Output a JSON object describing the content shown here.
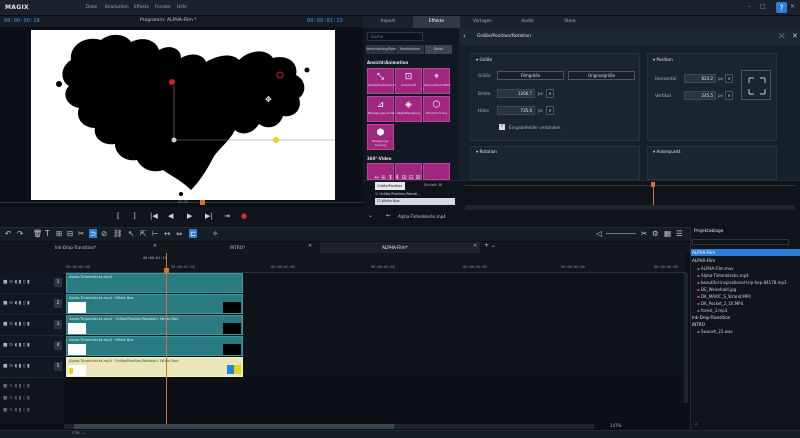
{
  "app": {
    "logo": "MAGIX"
  },
  "menu": [
    "Datei",
    "Bearbeiten",
    "Effekte",
    "Fenster",
    "Hilfe"
  ],
  "window_controls": [
    "–",
    "□",
    "✕"
  ],
  "preview": {
    "timecode_left": "00:00:00:28",
    "title": "Programm: ALPHA-Film *",
    "timecode_right": "00:00:01:23",
    "marker_label": "01:23",
    "controls": [
      "[",
      "]",
      "|◀",
      "◀",
      "▶",
      "▶|",
      "⇥",
      "●"
    ]
  },
  "right_tabs": [
    {
      "label": "Import",
      "active": false
    },
    {
      "label": "Effekte",
      "active": true
    },
    {
      "label": "Vorlagen",
      "active": false
    },
    {
      "label": "Audio",
      "active": false
    },
    {
      "label": "Store",
      "active": false
    }
  ],
  "effects": {
    "search_placeholder": "Suche",
    "subtabs": [
      "Verschiebung/Rotation",
      "Kombination",
      "Detail"
    ],
    "section_animation": "Ansicht/Animation",
    "section_360": "360°-Video",
    "tiles": [
      {
        "label": "Größe/Position/Rotation",
        "icon": "⤡"
      },
      {
        "label": "Ausschnitt",
        "icon": "⊡"
      },
      {
        "label": "Kamera/Zoomfahrt",
        "icon": "⌖"
      },
      {
        "label": "Bewegungsunschärfe",
        "icon": "⊿"
      },
      {
        "label": "Objektbewegung",
        "icon": "◈"
      },
      {
        "label": "3D-Verformung",
        "icon": "⬡"
      },
      {
        "label": "Bewegungs-tracking",
        "icon": "⬢"
      }
    ]
  },
  "properties": {
    "title": "Größe/Position/Rotation",
    "size_group": "Größe",
    "position_group": "Position",
    "rotation_group": "Rotation",
    "anchor_group": "Ankerpunkt",
    "size_label": "Größe",
    "filmsize_button": "Filmgröße",
    "originalsize_button": "Originalgröße",
    "width_label": "Breite",
    "width_value": "1206.7",
    "height_label": "Höhe",
    "height_value": "735.0",
    "unit": "px",
    "link_label": "Eingabefelder verbinden",
    "horizontal_label": "Horizontal",
    "horizontal_value": "623.2",
    "vertical_label": "Vertikal",
    "vertical_value": "245.5"
  },
  "mini_timeline": {
    "tab1": "Größe/Position",
    "tab2": "Einheit: Bl",
    "row1": "Größe/Position/Rotati...",
    "row2": "White Box",
    "clip_name": "Alpha-Tintenklecks.mp4"
  },
  "project_tabs": [
    {
      "label": "Ink-Drop-Transition*",
      "active": false
    },
    {
      "label": "INTRO*",
      "active": false
    },
    {
      "label": "ALPHA-Film*",
      "active": true
    }
  ],
  "ruler": {
    "top": "00:00:01:11",
    "ticks": [
      "00:00:00:00",
      "00:00:01:00",
      "00:00:02:00",
      "00:00:03:00",
      "00:00:04:00",
      "00:00:05:00",
      "00:00:06:00"
    ]
  },
  "tracks": [
    {
      "no": "1",
      "clip": "Alpha-Tintenklecks.mp4"
    },
    {
      "no": "2",
      "clip": "Alpha-Tintenklecks.mp4 · White Box"
    },
    {
      "no": "3",
      "clip": "Alpha-Tintenklecks.mp4 · Größe/Position/Rotation: White Box"
    },
    {
      "no": "4",
      "clip": "Alpha-Tintenklecks.mp4 · White Box"
    },
    {
      "no": "5",
      "clip": "Alpha-Tintenklecks.mp4 · Größe/Position/Rotation: White Box"
    }
  ],
  "tray": {
    "title": "Projektablage",
    "items": [
      {
        "type": "folder",
        "label": "ALPHA-Film"
      },
      {
        "type": "file",
        "label": "ALPHA-Film.mxv"
      },
      {
        "type": "file",
        "label": "Alpha-Tintenklecks.mp4"
      },
      {
        "type": "file",
        "label": "beautiful-inspirational-trip-hop-84178.mp3"
      },
      {
        "type": "file",
        "label": "DE_Weisshold.jpg"
      },
      {
        "type": "file",
        "label": "DK_MAVIC_S_Strand.MP4"
      },
      {
        "type": "file",
        "label": "DK_Pocket_2_16.MP4"
      },
      {
        "type": "file",
        "label": "forest_3.mp3"
      },
      {
        "type": "folder",
        "label": "Ink-Drop-Transition"
      },
      {
        "type": "folder",
        "label": "INTRO"
      },
      {
        "type": "file",
        "label": "Swoosh_22.wav"
      }
    ]
  },
  "status": {
    "cpu": "CPU: —",
    "zoom": "147%"
  }
}
